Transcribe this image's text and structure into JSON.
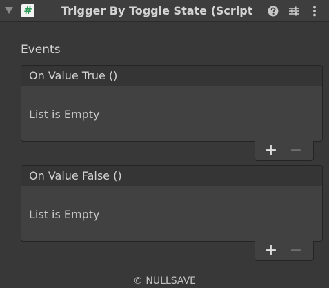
{
  "header": {
    "script_icon_glyph": "#",
    "title": "Trigger By Toggle State (Script",
    "icons": [
      "foldout-arrow-icon",
      "script-icon",
      "help-icon",
      "preset-icon",
      "menu-icon"
    ]
  },
  "events": {
    "label": "Events",
    "items": [
      {
        "title": "On Value True ()",
        "empty_text": "List is Empty",
        "add_label": "+",
        "remove_label": "−"
      },
      {
        "title": "On Value False ()",
        "empty_text": "List is Empty",
        "add_label": "+",
        "remove_label": "−"
      }
    ]
  },
  "footer": {
    "copyright": "© NULLSAVE"
  },
  "colors": {
    "background": "#383838",
    "header_background": "#3e3e3e",
    "script_icon_green": "#2f9b58",
    "text": "#d2d2d2",
    "disabled": "#6e6e6e"
  }
}
